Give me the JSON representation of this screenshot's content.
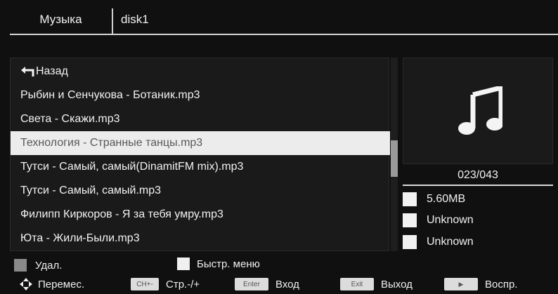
{
  "header": {
    "tab_label": "Музыка",
    "path": "disk1"
  },
  "list": {
    "back_label": "Назад",
    "items": [
      "Рыбин и Сенчукова - Ботаник.mp3",
      "Света - Скажи.mp3",
      "Технология - Странные танцы.mp3",
      "Тутси - Самый, самый(DinamitFM mix).mp3",
      "Тутси - Самый, самый.mp3",
      "Филипп Киркоров - Я за тебя умру.mp3",
      "Юта - Жили-Были.mp3"
    ],
    "selected_index": 2
  },
  "info": {
    "icon": "music-note-icon",
    "counter": "023/043",
    "size": "5.60MB",
    "artist": "Unknown",
    "album": "Unknown"
  },
  "hints": {
    "delete": "Удал.",
    "quick_menu": "Быстр. меню",
    "move": "Перемес.",
    "page_key": "CH+-",
    "page": "Стр.-/+",
    "enter_key": "Enter",
    "enter": "Вход",
    "exit_key": "Exit",
    "exit": "Выход",
    "play_key": "▶",
    "play": "Воспр."
  },
  "colors": {
    "background": "#101010",
    "selection": "#ececec",
    "selected_text": "#585858",
    "text": "#f2f2f2"
  }
}
